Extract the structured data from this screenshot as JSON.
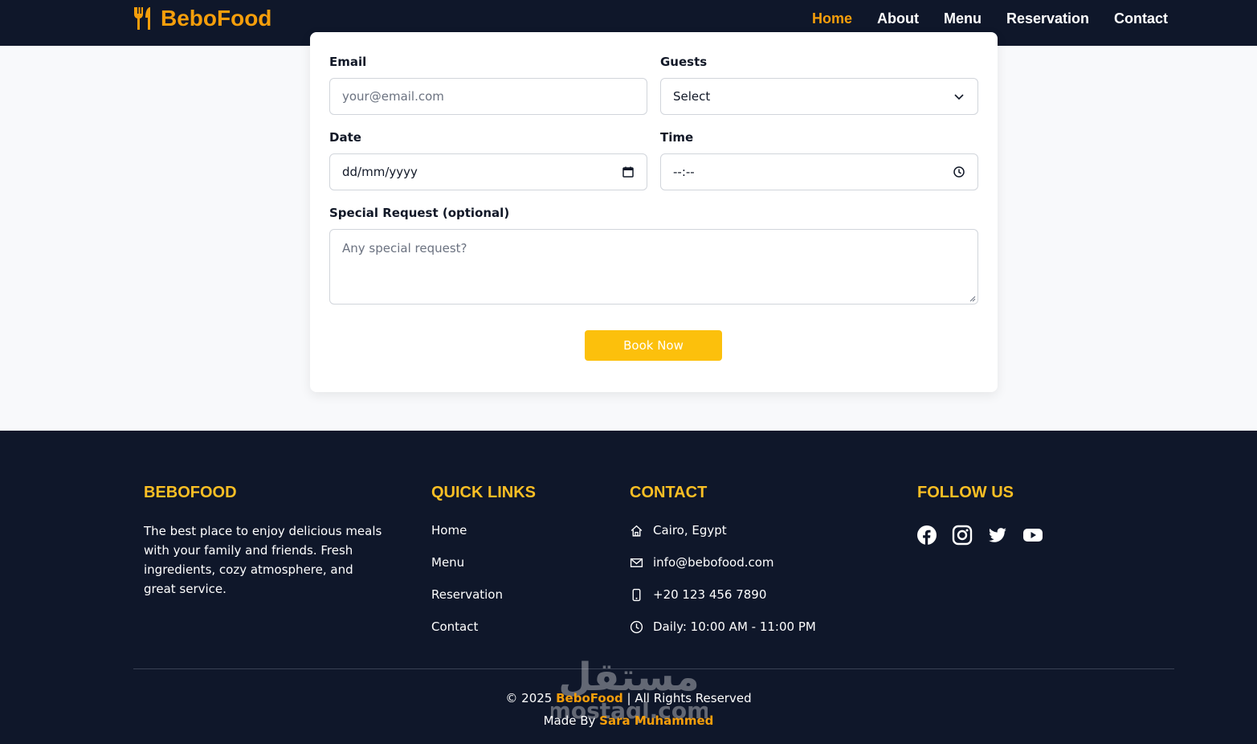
{
  "nav": {
    "brand": "BeboFood",
    "links": [
      {
        "label": "Home",
        "active": true
      },
      {
        "label": "About",
        "active": false
      },
      {
        "label": "Menu",
        "active": false
      },
      {
        "label": "Reservation",
        "active": false
      },
      {
        "label": "Contact",
        "active": false
      }
    ]
  },
  "form": {
    "email_label": "Email",
    "email_placeholder": "your@email.com",
    "guests_label": "Guests",
    "guests_value": "Select",
    "date_label": "Date",
    "date_placeholder": "dd/mm/yyyy",
    "time_label": "Time",
    "time_placeholder": "--:--",
    "request_label": "Special Request (optional)",
    "request_placeholder": "Any special request?",
    "submit_label": "Book Now"
  },
  "footer": {
    "about_title": "BEBOFOOD",
    "about_text": "The best place to enjoy delicious meals with your family and friends. Fresh ingredients, cozy atmosphere, and great service.",
    "links_title": "QUICK LINKS",
    "links": [
      "Home",
      "Menu",
      "Reservation",
      "Contact"
    ],
    "contact_title": "CONTACT",
    "contact": [
      {
        "icon": "home-icon",
        "text": "Cairo, Egypt"
      },
      {
        "icon": "envelope-icon",
        "text": "info@bebofood.com"
      },
      {
        "icon": "phone-icon",
        "text": "+20 123 456 7890"
      },
      {
        "icon": "clock-icon",
        "text": "Daily: 10:00 AM - 11:00 PM"
      }
    ],
    "follow_title": "FOLLOW US",
    "social": [
      "facebook-icon",
      "instagram-icon",
      "twitter-icon",
      "youtube-icon"
    ],
    "copyright_prefix": "© 2025 ",
    "copyright_brand": "BeboFood",
    "copyright_suffix": " | All Rights Reserved",
    "madeby_prefix": "Made By ",
    "madeby_name": "Sara Muhammed"
  },
  "watermark": {
    "arabic": "مستقل",
    "latin": "mostaql.com"
  },
  "colors": {
    "accent": "#f59e0b",
    "button": "#fcc00c",
    "dark": "#0f172a"
  }
}
